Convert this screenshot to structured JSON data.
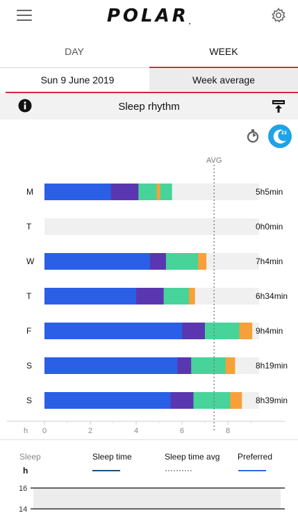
{
  "header": {
    "logo_text": "POLAR",
    "logo_mark": "."
  },
  "tabs": [
    {
      "label": "DAY"
    },
    {
      "label": "WEEK"
    }
  ],
  "selector": {
    "date": "Sun 9 June 2019",
    "average": "Week average"
  },
  "section": {
    "title": "Sleep rhythm"
  },
  "colors": {
    "deep_blue": "#2a5fe6",
    "purple": "#5a37b0",
    "green": "#47d39a",
    "orange": "#f7a03a",
    "track": "#f0f0f0",
    "accent_red": "#cf2a3a",
    "toggle_blue": "#1fa3e8"
  },
  "chart_data": {
    "type": "bar",
    "orientation": "horizontal",
    "stacked": true,
    "categories": [
      "M",
      "T",
      "W",
      "T",
      "F",
      "S",
      "S"
    ],
    "totals_labels": [
      "5h5min",
      "0h0min",
      "7h4min",
      "6h34min",
      "9h4min",
      "8h19min",
      "8h39min"
    ],
    "segments": [
      [
        {
          "c": "deep_blue",
          "v": 2.9
        },
        {
          "c": "purple",
          "v": 1.2
        },
        {
          "c": "green",
          "v": 0.8
        },
        {
          "c": "orange",
          "v": 0.15
        },
        {
          "c": "green",
          "v": 0.5
        }
      ],
      [],
      [
        {
          "c": "deep_blue",
          "v": 4.6
        },
        {
          "c": "purple",
          "v": 0.7
        },
        {
          "c": "green",
          "v": 1.4
        },
        {
          "c": "orange",
          "v": 0.35
        }
      ],
      [
        {
          "c": "deep_blue",
          "v": 4.0
        },
        {
          "c": "purple",
          "v": 1.2
        },
        {
          "c": "green",
          "v": 1.1
        },
        {
          "c": "orange",
          "v": 0.25
        }
      ],
      [
        {
          "c": "deep_blue",
          "v": 6.0
        },
        {
          "c": "purple",
          "v": 1.0
        },
        {
          "c": "green",
          "v": 1.5
        },
        {
          "c": "orange",
          "v": 0.55
        }
      ],
      [
        {
          "c": "deep_blue",
          "v": 5.8
        },
        {
          "c": "purple",
          "v": 0.6
        },
        {
          "c": "green",
          "v": 1.5
        },
        {
          "c": "orange",
          "v": 0.4
        }
      ],
      [
        {
          "c": "deep_blue",
          "v": 5.5
        },
        {
          "c": "purple",
          "v": 1.0
        },
        {
          "c": "green",
          "v": 1.6
        },
        {
          "c": "orange",
          "v": 0.5
        }
      ]
    ],
    "track_max": 9.0,
    "avg_value": 7.4,
    "avg_label": "AVG",
    "x_ticks": [
      0,
      2,
      4,
      6,
      8
    ],
    "x_unit_label": "h",
    "xlim": [
      0,
      9.0
    ]
  },
  "legend": {
    "axis_title": "Sleep",
    "axis_unit": "h",
    "items": [
      {
        "label": "Sleep time"
      },
      {
        "label": "Sleep time avg"
      },
      {
        "label": "Preferred"
      }
    ]
  },
  "lower_chart": {
    "y_ticks": [
      "16",
      "14"
    ]
  }
}
